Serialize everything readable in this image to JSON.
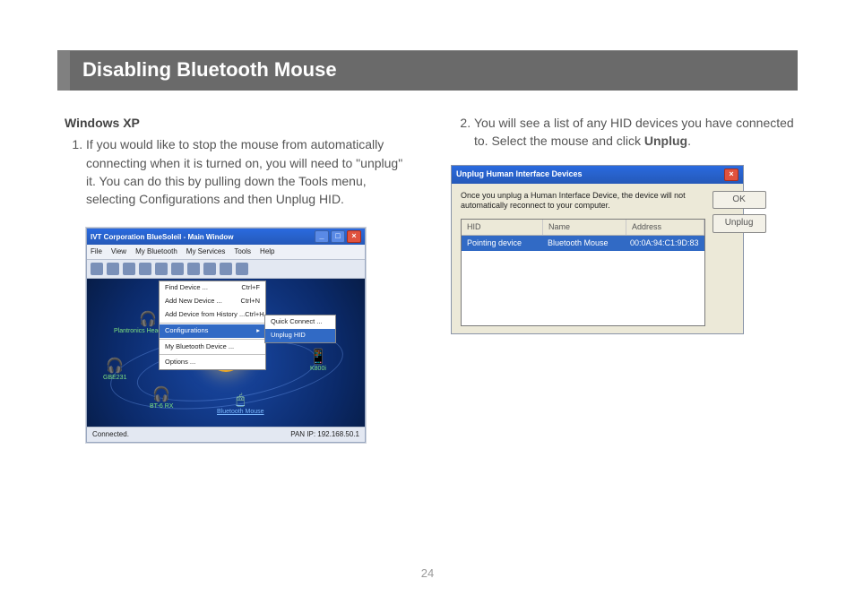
{
  "page_number": "24",
  "heading": "Disabling Bluetooth Mouse",
  "left": {
    "subhead": "Windows XP",
    "step1": "If you would like to stop the mouse from automatically connecting when it is turned on, you will need to \"unplug\" it. You can do this by pulling down the Tools menu, selecting Configurations and then Unplug HID."
  },
  "right": {
    "step2_a": "You will see a list of any HID devices you have connected to. Select the mouse and click ",
    "step2_b": "Unplug",
    "step2_c": "."
  },
  "bluesoleil": {
    "title": "IVT Corporation BlueSoleil - Main Window",
    "menu": {
      "file": "File",
      "view": "View",
      "mybt": "My Bluetooth",
      "myserv": "My Services",
      "tools": "Tools",
      "help": "Help"
    },
    "tools_menu": {
      "find": "Find Device ...",
      "find_sc": "Ctrl+F",
      "add": "Add New Device ...",
      "add_sc": "Ctrl+N",
      "hist": "Add Device from History ...",
      "hist_sc": "Ctrl+H",
      "conf": "Configurations",
      "mybtdev": "My Bluetooth Device ...",
      "opt": "Options ..."
    },
    "submenu": {
      "qc": "Quick Connect ...",
      "uh": "Unplug HID"
    },
    "devices": {
      "d1": "Plantronics Headphones",
      "d2": "GBE231",
      "d3": "BT-6 RX",
      "d4": "Bluetooth Mouse",
      "d5": "K800i"
    },
    "status_left": "Connected.",
    "status_right": "PAN IP: 192.168.50.1"
  },
  "dialog": {
    "title": "Unplug Human Interface Devices",
    "text": "Once you unplug a Human Interface Device, the device will not automatically reconnect to your computer.",
    "hdr": {
      "c1": "HID",
      "c2": "Name",
      "c3": "Address"
    },
    "row": {
      "c1": "Pointing device",
      "c2": "Bluetooth Mouse",
      "c3": "00:0A:94:C1:9D:83"
    },
    "ok": "OK",
    "unplug": "Unplug"
  }
}
